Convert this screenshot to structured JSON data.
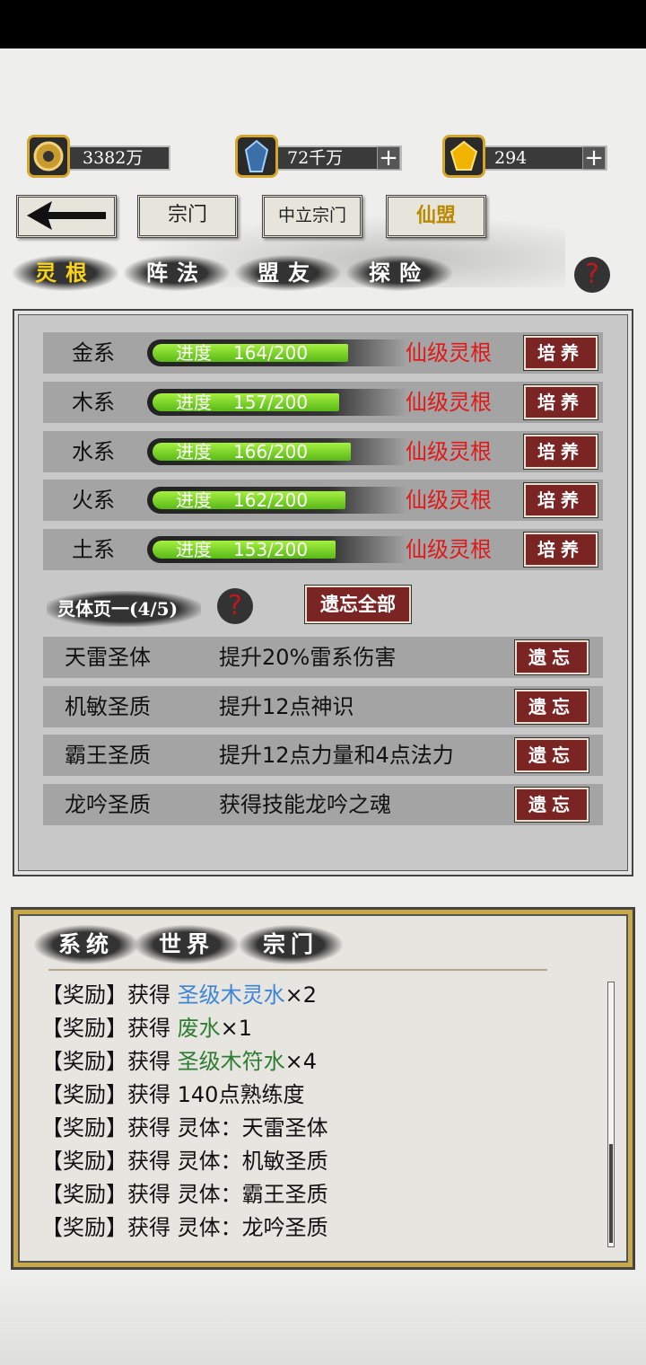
{
  "resources": [
    {
      "icon": "coin-icon",
      "value": "3382万",
      "has_plus": false
    },
    {
      "icon": "blue-crystal-icon",
      "value": "72千万",
      "has_plus": true
    },
    {
      "icon": "gold-gem-icon",
      "value": "294",
      "has_plus": true
    }
  ],
  "nav": {
    "back_icon": "arrow-left-icon",
    "buttons": [
      "宗门",
      "中立宗门",
      "仙盟"
    ]
  },
  "subtabs": [
    "灵根",
    "阵法",
    "盟友",
    "探险"
  ],
  "help_glyph": "?",
  "roots": {
    "progress_label": "进度",
    "items": [
      {
        "name": "金系",
        "progress": "164/200",
        "current": 164,
        "max": 200,
        "grade": "仙级灵根",
        "button": "培养"
      },
      {
        "name": "木系",
        "progress": "157/200",
        "current": 157,
        "max": 200,
        "grade": "仙级灵根",
        "button": "培养"
      },
      {
        "name": "水系",
        "progress": "166/200",
        "current": 166,
        "max": 200,
        "grade": "仙级灵根",
        "button": "培养"
      },
      {
        "name": "火系",
        "progress": "162/200",
        "current": 162,
        "max": 200,
        "grade": "仙级灵根",
        "button": "培养"
      },
      {
        "name": "土系",
        "progress": "153/200",
        "current": 153,
        "max": 200,
        "grade": "仙级灵根",
        "button": "培养"
      }
    ]
  },
  "body": {
    "title": "灵体页一(4/5)",
    "forget_all": "遗忘全部",
    "items": [
      {
        "name": "天雷圣体",
        "desc": "提升20%雷系伤害",
        "button": "遗忘"
      },
      {
        "name": "机敏圣质",
        "desc": "提升12点神识",
        "button": "遗忘"
      },
      {
        "name": "霸王圣质",
        "desc": "提升12点力量和4点法力",
        "button": "遗忘"
      },
      {
        "name": "龙吟圣质",
        "desc": "获得技能龙吟之魂",
        "button": "遗忘"
      }
    ]
  },
  "chat": {
    "tabs": [
      "系统",
      "世界",
      "宗门"
    ],
    "lines": [
      {
        "prefix": "【奖励】获得 ",
        "item": "圣级木灵水",
        "item_color": "#3d85d6",
        "suffix": "×2"
      },
      {
        "prefix": "【奖励】获得 ",
        "item": "废水",
        "item_color": "#2e7d32",
        "suffix": "×1"
      },
      {
        "prefix": "【奖励】获得 ",
        "item": "圣级木符水",
        "item_color": "#2e7d32",
        "suffix": "×4"
      },
      {
        "prefix": "【奖励】获得 ",
        "item": "",
        "item_color": "#111111",
        "suffix": "140点熟练度"
      },
      {
        "prefix": "【奖励】获得 ",
        "item": "",
        "item_color": "#111111",
        "suffix": "灵体：天雷圣体"
      },
      {
        "prefix": "【奖励】获得 ",
        "item": "",
        "item_color": "#111111",
        "suffix": "灵体：机敏圣质"
      },
      {
        "prefix": "【奖励】获得 ",
        "item": "",
        "item_color": "#111111",
        "suffix": "灵体：霸王圣质"
      },
      {
        "prefix": "【奖励】获得 ",
        "item": "",
        "item_color": "#111111",
        "suffix": "灵体：龙吟圣质"
      }
    ]
  },
  "colors": {
    "grade_red": "#e01818",
    "button_maroon": "#7b2424",
    "active_tab_yellow": "#f6d21b"
  }
}
